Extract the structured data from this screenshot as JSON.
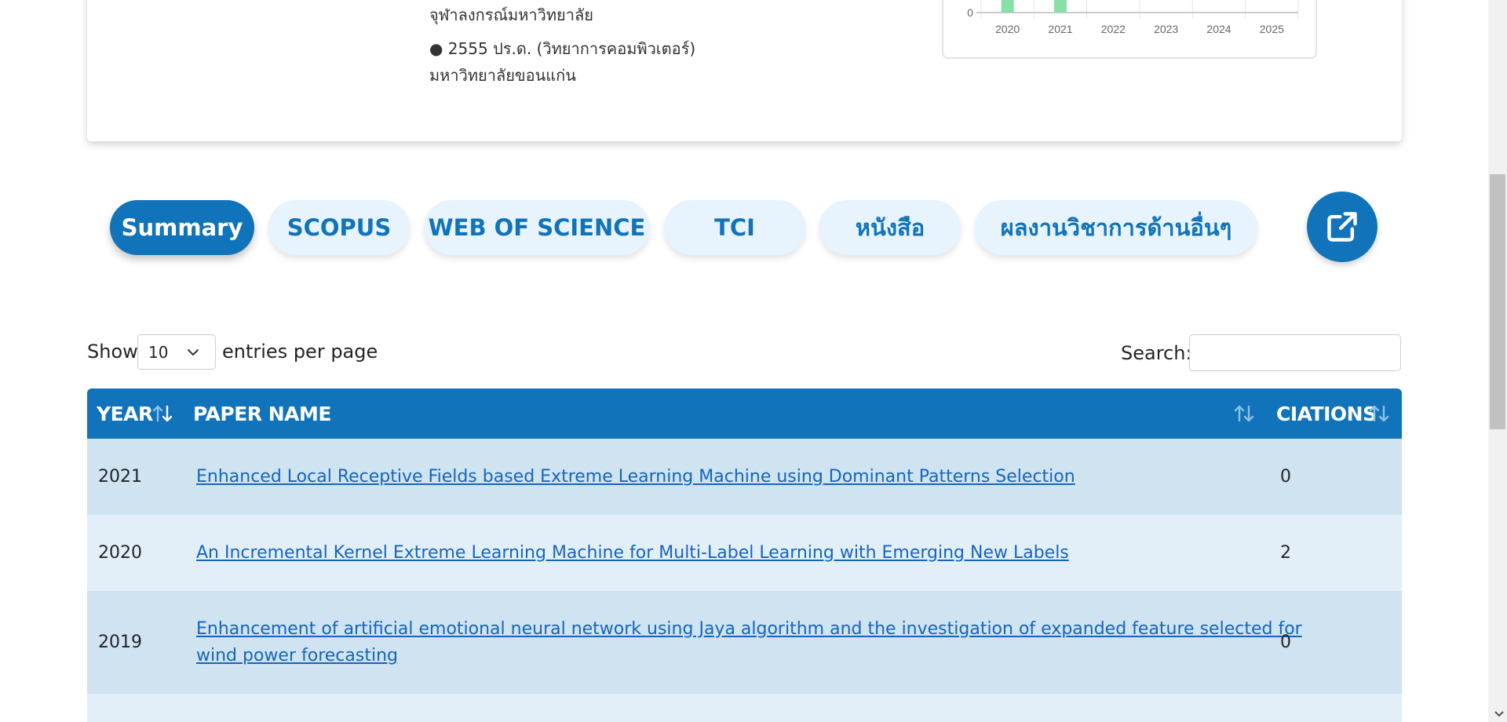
{
  "profile": {
    "education": [
      "จุฬาลงกรณ์มหาวิทยาลัย",
      "● 2555 ปร.ด. (วิทยาการคอมพิวเตอร์)",
      "มหาวิทยาลัยขอนแก่น"
    ]
  },
  "chart_data": {
    "type": "bar",
    "categories": [
      "2020",
      "2021",
      "2022",
      "2023",
      "2024",
      "2025"
    ],
    "y_tick_labels": [
      "0"
    ],
    "bar_color": "#86e0a8",
    "visible_bar_categories": [
      "2020",
      "2021"
    ]
  },
  "tabs": [
    {
      "label": "Summary",
      "active": true
    },
    {
      "label": "SCOPUS",
      "active": false
    },
    {
      "label": "WEB OF SCIENCE",
      "active": false
    },
    {
      "label": "TCI",
      "active": false
    },
    {
      "label": "หนังสือ",
      "active": false
    },
    {
      "label": "ผลงานวิชาการด้านอื่นๆ",
      "active": false
    }
  ],
  "export_button": {
    "icon": "external-link-icon"
  },
  "datatable": {
    "show_label": "Show",
    "entries_value": "10",
    "entries_suffix": "entries per page",
    "search_label": "Search:",
    "search_value": ""
  },
  "table": {
    "columns": [
      "YEAR",
      "PAPER NAME",
      "CIATIONS"
    ],
    "rows": [
      {
        "year": "2021",
        "paper": "Enhanced Local Receptive Fields based Extreme Learning Machine using Dominant Patterns Selection",
        "citations": "0"
      },
      {
        "year": "2020",
        "paper": "An Incremental Kernel Extreme Learning Machine for Multi-Label Learning with Emerging New Labels",
        "citations": "2"
      },
      {
        "year": "2019",
        "paper": "Enhancement of artificial emotional neural network using Jaya algorithm and the investigation of expanded feature selected for wind power forecasting",
        "citations": "0"
      }
    ]
  },
  "colors": {
    "primary": "#1173ba",
    "tab_inactive_bg": "#e7f3fd",
    "row_odd": "#cfe3f0",
    "row_even": "#e3eff8",
    "link": "#1565c0"
  }
}
